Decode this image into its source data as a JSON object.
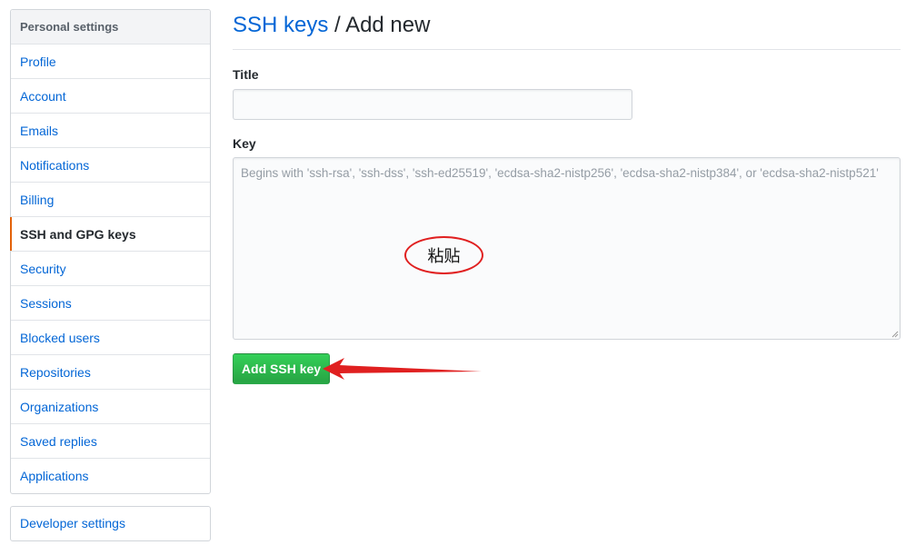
{
  "sidebar": {
    "header": "Personal settings",
    "items": [
      {
        "label": "Profile"
      },
      {
        "label": "Account"
      },
      {
        "label": "Emails"
      },
      {
        "label": "Notifications"
      },
      {
        "label": "Billing"
      },
      {
        "label": "SSH and GPG keys",
        "selected": true
      },
      {
        "label": "Security"
      },
      {
        "label": "Sessions"
      },
      {
        "label": "Blocked users"
      },
      {
        "label": "Repositories"
      },
      {
        "label": "Organizations"
      },
      {
        "label": "Saved replies"
      },
      {
        "label": "Applications"
      }
    ],
    "developer_settings": "Developer settings"
  },
  "main": {
    "breadcrumb_link": "SSH keys",
    "separator": "/",
    "page_title": "Add new",
    "title_label": "Title",
    "title_value": "",
    "key_label": "Key",
    "key_value": "",
    "key_placeholder": "Begins with 'ssh-rsa', 'ssh-dss', 'ssh-ed25519', 'ecdsa-sha2-nistp256', 'ecdsa-sha2-nistp384', or 'ecdsa-sha2-nistp521'",
    "add_button_label": "Add SSH key"
  },
  "annotation": {
    "paste_text": "粘贴",
    "color": "#e02020"
  },
  "colors": {
    "link": "#0366d6",
    "selected_marker": "#e36209",
    "button_green": "#28a745"
  }
}
